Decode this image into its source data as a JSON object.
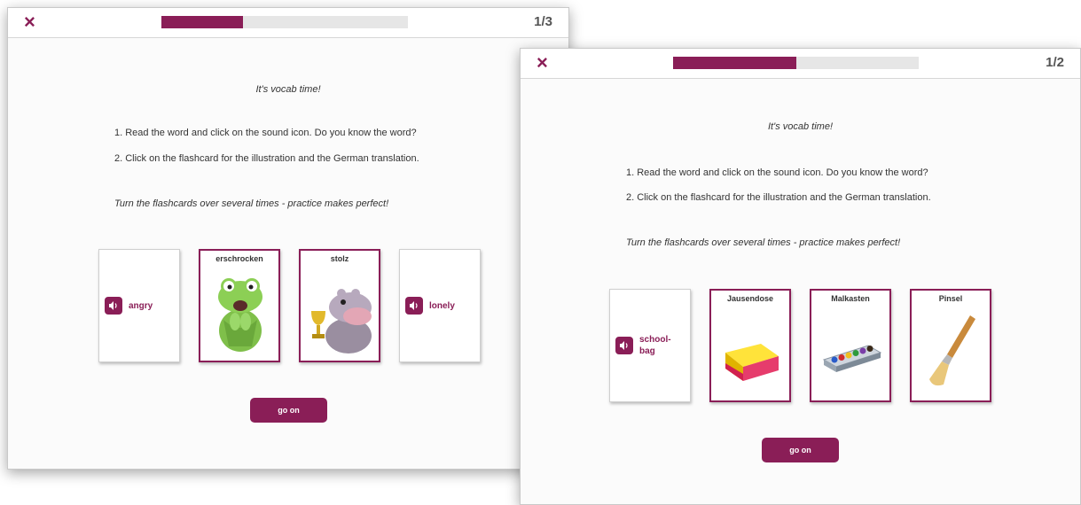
{
  "colors": {
    "accent": "#8a1e57",
    "track": "#e6e6e6"
  },
  "screen1": {
    "close_icon": "×",
    "progress": 0.33,
    "counter": "1/3",
    "intro": "It's vocab time!",
    "step1": "1. Read the word and click on the sound icon. Do you know the word?",
    "step2": "2. Click on the flashcard for the illustration and the German translation.",
    "hint": "Turn the flashcards over several times - practice makes perfect!",
    "cards": [
      {
        "state": "front",
        "word": "angry",
        "icon": "sound-icon"
      },
      {
        "state": "back",
        "title": "erschrocken",
        "image": "frog-illustration"
      },
      {
        "state": "back",
        "title": "stolz",
        "image": "hippo-trophy-illustration"
      },
      {
        "state": "front",
        "word": "lonely",
        "icon": "sound-icon"
      }
    ],
    "go_on": "go on"
  },
  "screen2": {
    "close_icon": "×",
    "progress": 0.5,
    "counter": "1/2",
    "intro": "It's vocab time!",
    "step1": "1. Read the word and click on the sound icon. Do you know the word?",
    "step2": "2. Click on the flashcard for the illustration and the German translation.",
    "hint": "Turn the flashcards over several times - practice makes perfect!",
    "cards": [
      {
        "state": "front",
        "word_line1": "school-",
        "word_line2": "bag",
        "icon": "sound-icon"
      },
      {
        "state": "back",
        "title": "Jausendose",
        "image": "lunchbox-illustration"
      },
      {
        "state": "back",
        "title": "Malkasten",
        "image": "paintbox-illustration"
      },
      {
        "state": "back",
        "title": "Pinsel",
        "image": "brush-illustration"
      }
    ],
    "go_on": "go on"
  }
}
